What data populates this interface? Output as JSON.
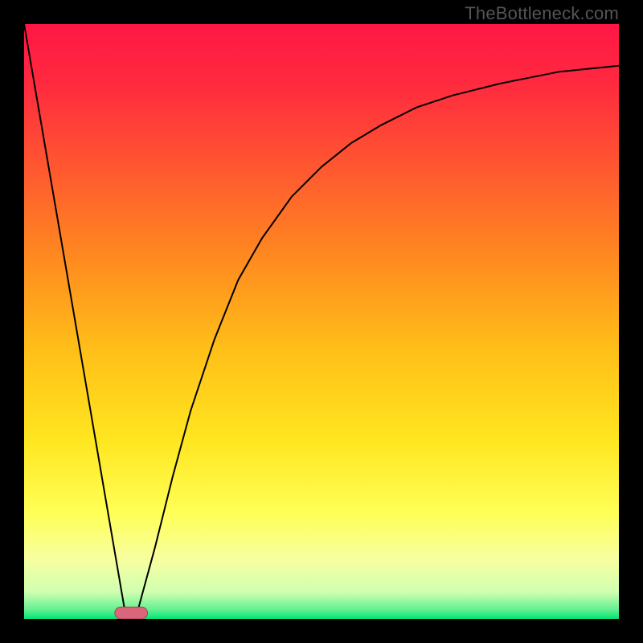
{
  "watermark": "TheBottleneck.com",
  "chart_data": {
    "type": "line",
    "title": "",
    "xlabel": "",
    "ylabel": "",
    "xlim": [
      0,
      100
    ],
    "ylim": [
      0,
      100
    ],
    "grid": false,
    "legend": false,
    "background_gradient_stops": [
      {
        "offset": 0.0,
        "color": "#ff1744"
      },
      {
        "offset": 0.1,
        "color": "#ff2a3f"
      },
      {
        "offset": 0.25,
        "color": "#ff5a2f"
      },
      {
        "offset": 0.4,
        "color": "#ff8c1f"
      },
      {
        "offset": 0.55,
        "color": "#ffc018"
      },
      {
        "offset": 0.7,
        "color": "#ffe620"
      },
      {
        "offset": 0.82,
        "color": "#ffff55"
      },
      {
        "offset": 0.9,
        "color": "#f7ffa0"
      },
      {
        "offset": 0.955,
        "color": "#d0ffb0"
      },
      {
        "offset": 0.985,
        "color": "#60f090"
      },
      {
        "offset": 1.0,
        "color": "#00e676"
      }
    ],
    "series": [
      {
        "name": "left-line",
        "color": "#000000",
        "x": [
          0,
          17
        ],
        "y": [
          100,
          1
        ]
      },
      {
        "name": "right-curve",
        "color": "#000000",
        "x": [
          19,
          22,
          25,
          28,
          32,
          36,
          40,
          45,
          50,
          55,
          60,
          66,
          72,
          80,
          90,
          100
        ],
        "y": [
          1,
          12,
          24,
          35,
          47,
          57,
          64,
          71,
          76,
          80,
          83,
          86,
          88,
          90,
          92,
          93
        ]
      }
    ],
    "marker": {
      "name": "min-marker",
      "shape": "rounded-rect",
      "x": 18,
      "y": 1,
      "width": 5.5,
      "height": 2,
      "fill": "#d9667a",
      "stroke": "#b04055"
    }
  }
}
